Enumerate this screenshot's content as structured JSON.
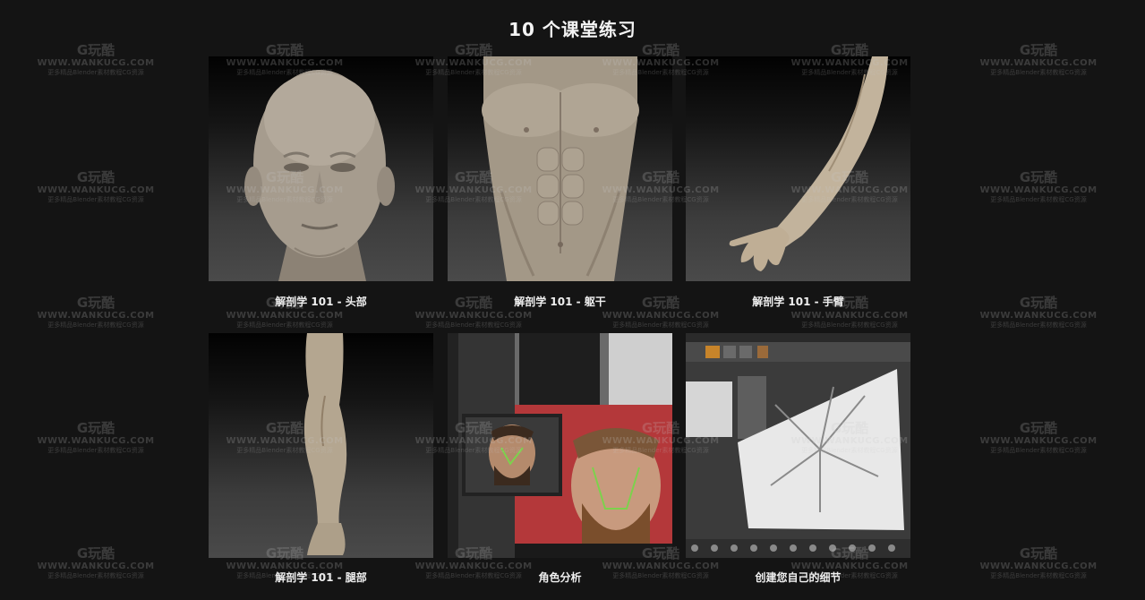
{
  "page": {
    "title": "10 个课堂练习"
  },
  "cards": [
    {
      "caption": "解剖学 101 - 头部",
      "icon": "head-sculpt-icon"
    },
    {
      "caption": "解剖学 101 - 躯干",
      "icon": "torso-sculpt-icon"
    },
    {
      "caption": "解剖学 101 - 手臂",
      "icon": "arm-sculpt-icon"
    },
    {
      "caption": "解剖学 101 - 腿部",
      "icon": "leg-sculpt-icon"
    },
    {
      "caption": "角色分析",
      "icon": "face-reference-icon"
    },
    {
      "caption": "创建您自己的细节",
      "icon": "zbrush-interface-icon"
    }
  ],
  "watermark": {
    "logo": "G玩酷",
    "site": "WWW.WANKUCG.COM",
    "slogan": "更多精品Blender素材教程CG资源"
  }
}
